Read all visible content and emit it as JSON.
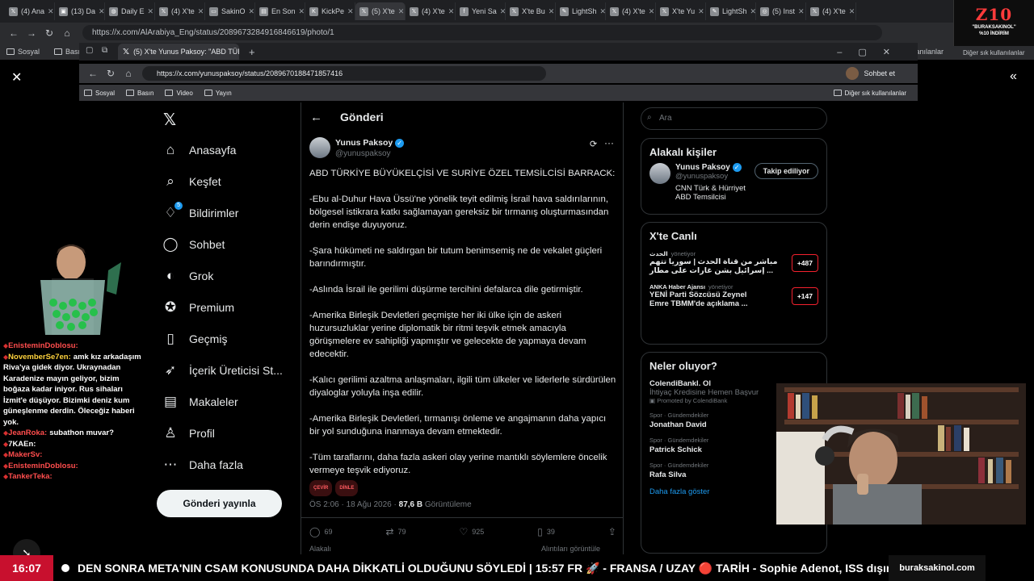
{
  "outer_browser": {
    "tabs": [
      {
        "label": "(4) Ana",
        "icon": "x-icon"
      },
      {
        "label": "(13) Da",
        "icon": "app-icon"
      },
      {
        "label": "Daily E",
        "icon": "globe-icon"
      },
      {
        "label": "(4) X'te",
        "icon": "x-icon"
      },
      {
        "label": "SakinO",
        "icon": "tv-icon"
      },
      {
        "label": "En Son",
        "icon": "news-icon"
      },
      {
        "label": "KickPe",
        "icon": "kick-icon"
      },
      {
        "label": "(5) X'te",
        "icon": "x-icon"
      },
      {
        "label": "(4) X'te",
        "icon": "x-icon"
      },
      {
        "label": "Yeni Sa",
        "icon": "facebook-icon"
      },
      {
        "label": "X'te Bu",
        "icon": "x-icon"
      },
      {
        "label": "LightSh",
        "icon": "pen-icon"
      },
      {
        "label": "(4) X'te",
        "icon": "x-icon"
      },
      {
        "label": "X'te Yu",
        "icon": "x-icon"
      },
      {
        "label": "LightSh",
        "icon": "pen-icon"
      },
      {
        "label": "(5) Inst",
        "icon": "instagram-icon"
      },
      {
        "label": "(4) X'te",
        "icon": "x-icon"
      }
    ],
    "url": "https://x.com/AlArabiya_Eng/status/2089673284916846619/photo/1",
    "bookmarks": [
      "Sosyal",
      "Basın"
    ],
    "other_bookmarks": "Diğer sık kullanılanlar"
  },
  "overlay_logo": {
    "logo": "Z10",
    "line1": "\"BURAKSAKINOL\"",
    "line2": "%10 İNDİRİM"
  },
  "inner_browser": {
    "tab_label": "(5) X'te Yunus Paksoy: \"ABD TÜRKİ",
    "url": "https://x.com/yunuspaksoy/status/2089670188471857416",
    "bookmarks": [
      "Sosyal",
      "Basın",
      "Video",
      "Yayın"
    ],
    "other_bookmarks": "Diğer sık kullanılanlar",
    "chat_button": "Sohbet et"
  },
  "sidebar": {
    "items": [
      {
        "label": "Anasayfa",
        "icon": "home-icon"
      },
      {
        "label": "Keşfet",
        "icon": "search-icon"
      },
      {
        "label": "Bildirimler",
        "icon": "bell-icon",
        "badge": "5"
      },
      {
        "label": "Sohbet",
        "icon": "chat-icon"
      },
      {
        "label": "Grok",
        "icon": "grok-icon"
      },
      {
        "label": "Premium",
        "icon": "premium-icon"
      },
      {
        "label": "Geçmiş",
        "icon": "bookmark-icon"
      },
      {
        "label": "İçerik Üreticisi St...",
        "icon": "rocket-icon"
      },
      {
        "label": "Makaleler",
        "icon": "article-icon"
      },
      {
        "label": "Profil",
        "icon": "person-icon"
      },
      {
        "label": "Daha fazla",
        "icon": "more-circle-icon"
      }
    ],
    "post_button": "Gönderi yayınla"
  },
  "column": {
    "title": "Gönderi",
    "author": {
      "name": "Yunus Paksoy",
      "handle": "@yunuspaksoy"
    },
    "paragraphs": [
      "ABD TÜRKİYE BÜYÜKELÇİSİ VE SURİYE ÖZEL TEMSİLCİSİ BARRACK:",
      "-Ebu al-Duhur Hava Üssü'ne yönelik teyit edilmiş İsrail hava saldırılarının, bölgesel istikrara katkı sağlamayan gereksiz bir tırmanış oluşturmasından derin endişe duyuyoruz.",
      "-Şara hükümeti ne saldırgan bir tutum benimsemiş ne de vekalet güçleri barındırmıştır.",
      "-Aslında İsrail ile gerilimi düşürme tercihini defalarca dile getirmiştir.",
      "-Amerika Birleşik Devletleri geçmişte her iki ülke için de askeri huzursuzluklar yerine diplomatik bir ritmi teşvik etmek amacıyla görüşmelere ev sahipliği yapmıştır ve gelecekte de yapmaya devam edecektir.",
      "-Kalıcı gerilimi azaltma anlaşmaları, ilgili tüm ülkeler ve liderlerle sürdürülen diyaloglar yoluyla inşa edilir.",
      "-Amerika Birleşik Devletleri, tırmanışı önleme ve angajmanın daha yapıcı bir yol sunduğuna inanmaya devam etmektedir.",
      "-Tüm taraflarını, daha fazla askeri olay yerine mantıklı söylemlere öncelik vermeye teşvik ediyoruz."
    ],
    "tags": [
      "ÇEVİR",
      "DİNLE"
    ],
    "time": "ÖS 2:06 · 18 Ağu 2026 · ",
    "views": "87,6 B",
    "views_label": " Görüntüleme",
    "actions": {
      "replies": "69",
      "reposts": "79",
      "likes": "925",
      "bookmarks": "39"
    },
    "related_left": "Alakalı",
    "related_right": "Alıntıları görüntüle"
  },
  "right": {
    "search_placeholder": "Ara",
    "related_people_title": "Alakalı kişiler",
    "person": {
      "name": "Yunus Paksoy",
      "handle": "@yunuspaksoy",
      "bio": "CNN Türk & Hürriyet ABD Temsilcisi",
      "button": "Takip ediliyor"
    },
    "live_title": "X'te Canlı",
    "live": [
      {
        "source": "الحدث",
        "role": "yönetiyor",
        "text1": "مباشر من قناة الحدث | سوريا تتهم",
        "text2": "إسرائيل بشن غارات على مطار ...",
        "count": "+487"
      },
      {
        "source": "ANKA Haber Ajansı",
        "role": "yönetiyor",
        "text1": "YENİ Parti Sözcüsü Zeynel",
        "text2": "Emre TBMM'de açıklama ...",
        "count": "+147"
      }
    ],
    "trends_title": "Neler oluyor?",
    "promo": {
      "title": "ColendiBankl. Ol",
      "text": "İhtiyaç Kredisine Hemen Başvur",
      "label": "Promoted by ColendiBank"
    },
    "trends": [
      {
        "category": "Spor · Gündemdekiler",
        "name": "Jonathan David"
      },
      {
        "category": "Spor · Gündemdekiler",
        "name": "Patrick Schick"
      },
      {
        "category": "Spor · Gündemdekiler",
        "name": "Rafa Silva"
      }
    ],
    "show_more": "Daha fazla göster"
  },
  "chat": [
    {
      "user": "EnisteminDoblosu:",
      "msg": "",
      "color": "#ff4d4d"
    },
    {
      "user": "NovemberSe7en:",
      "msg": "amk kız arkadaşım Riva'ya gidek diyor. Ukraynadan Karadenize mayın geliyor, bizim boğaza kadar iniyor. Rus sihaları İzmit'e düşüyor. Bizimki deniz kum güneşlenme derdin. Öleceğiz haberi yok.",
      "color": "#ffd33d"
    },
    {
      "user": "JeanRoka:",
      "msg": "subathon muvar?",
      "color": "#ff4d4d"
    },
    {
      "user": "7KAEn:",
      "msg": "",
      "color": "#ffffff"
    },
    {
      "user": "MakerSv:",
      "msg": "",
      "color": "#ff4d4d"
    },
    {
      "user": "EnisteminDoblosu:",
      "msg": "",
      "color": "#ff4d4d"
    },
    {
      "user": "TankerTeka:",
      "msg": "",
      "color": "#ff4d4d"
    }
  ],
  "ticker": {
    "clock": "16:07",
    "text": "DEN SONRA META'NIN CSAM KONUSUNDA DAHA DİKKATLİ OLDUĞUNU SÖYLEDİ   |   15:57  FR 🚀 - FRANSA / UZAY  🔴 TARİH - Sophie Adenot, ISS dışında",
    "brand": "buraksakinol.com"
  }
}
